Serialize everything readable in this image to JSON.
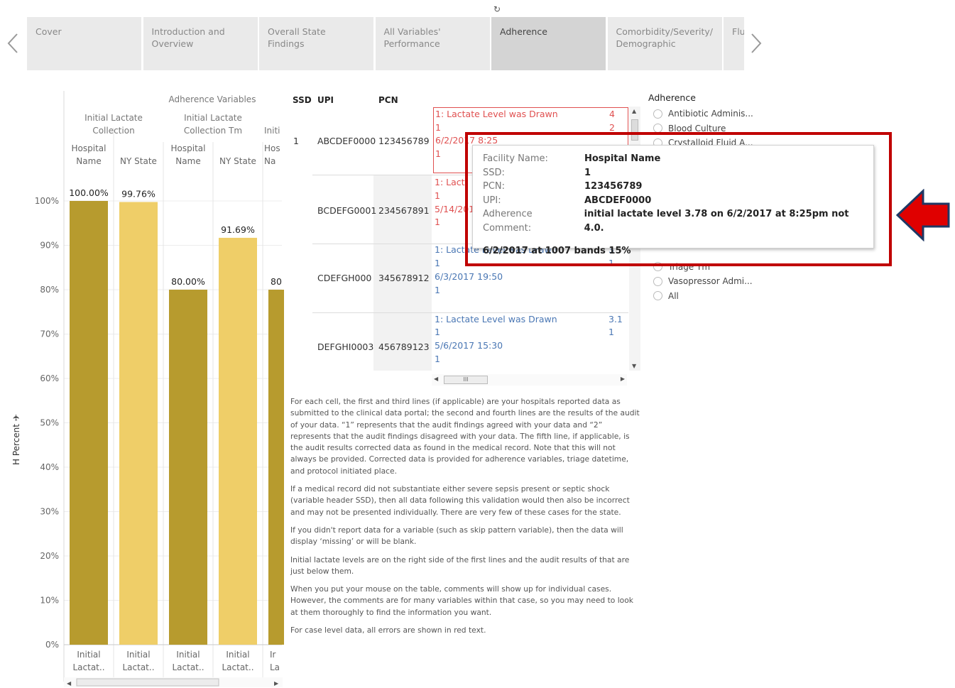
{
  "toolbar": {
    "reset_icon": "revert-icon",
    "reset_glyph": "↻"
  },
  "tabs": [
    {
      "label": "Cover"
    },
    {
      "label": "Introduction and Overview"
    },
    {
      "label": "Overall State Findings"
    },
    {
      "label": "All Variables' Performance"
    },
    {
      "label": "Adherence"
    },
    {
      "label": "Comorbidity/Severity/ Demographic"
    },
    {
      "label": "Flu"
    }
  ],
  "chart_data": {
    "type": "bar",
    "group_title": "Adherence Variables",
    "groups": [
      "Initial Lactate Collection",
      "Initial Lactate Collection Tm",
      "Initi"
    ],
    "subheaders": [
      "Hospital Name",
      "NY State",
      "Hospital Name",
      "NY State",
      "Hos Na"
    ],
    "categories": [
      "Initial Lactat..",
      "Initial Lactat..",
      "Initial Lactat..",
      "Initial Lactat..",
      "Ir La"
    ],
    "series": [
      {
        "values": [
          100.0,
          99.76,
          80.0,
          91.69,
          80.0
        ]
      }
    ],
    "data_labels": [
      "100.00%",
      "99.76%",
      "80.00%",
      "91.69%",
      "80"
    ],
    "ylabel": "H Percent",
    "yticks": [
      "0%",
      "10%",
      "20%",
      "30%",
      "40%",
      "50%",
      "60%",
      "70%",
      "80%",
      "90%",
      "100%"
    ],
    "ylim": [
      0,
      100
    ],
    "colors": {
      "hospital": "#b79b2e",
      "state": "#efce68"
    }
  },
  "table": {
    "headers": {
      "ssd": "SSD",
      "upi": "UPI",
      "pcn": "PCN"
    },
    "rows": [
      {
        "ssd": "1",
        "upi": "ABCDEF0000",
        "pcn": "123456789",
        "l1": "1: Lactate Level was Drawn",
        "l2": "1",
        "l3": "6/2/2017 8:25",
        "l4": "1",
        "v1": "4",
        "v2": "2",
        "error": true
      },
      {
        "ssd": "",
        "upi": "BCDEFG0001",
        "pcn": "234567891",
        "l1": "1: Lact",
        "l2": "1",
        "l3": "5/14/201",
        "l4": "1",
        "v1": "",
        "v2": "",
        "error": true
      },
      {
        "ssd": "",
        "upi": "CDEFGH000",
        "pcn": "345678912",
        "l1": "1: Lactate Level was Drawn",
        "l2": "1",
        "l3": "6/3/2017 19:50",
        "l4": "1",
        "v1": "3",
        "v2": "1",
        "error": false
      },
      {
        "ssd": "",
        "upi": "DEFGHI0003",
        "pcn": "456789123",
        "l1": "1: Lactate Level was Drawn",
        "l2": "1",
        "l3": "5/6/2017 15:30",
        "l4": "1",
        "v1": "3.1",
        "v2": "1",
        "error": false
      }
    ]
  },
  "notes": [
    "For each cell, the first and third lines (if applicable) are your hospitals reported data as submitted to the clinical data portal; the second and fourth lines are the results of the audit of your data. “1” represents that the audit findings agreed with your data and “2” represents that the audit findings disagreed with your data. The fifth line, if applicable, is the audit results corrected data as found in the medical record.  Note that this will not always be provided.  Corrected data is provided for adherence variables, triage datetime, and protocol initiated place.",
    "If a medical record did not substantiate either severe sepsis present or septic shock (variable header SSD), then all data following this validation would then also be incorrect and may not be presented individually.  There are very few of these cases for the state.",
    "If you didn't report data for a variable (such as skip pattern variable), then the data will display ‘missing’ or will be blank.",
    "Initial lactate levels are on the right side of the first lines and the audit results of that are just below them.",
    "When you put your mouse on the table, comments will show up for individual cases. However, the comments are for many variables within that case, so you may need to look at them thoroughly to find the information you want.",
    "For case level data, all errors are shown in red text."
  ],
  "filter": {
    "title": "Adherence",
    "top_items": [
      "Antibiotic Adminis...",
      "Blood Culture",
      "Crystalloid Fluid A..."
    ],
    "bottom_items": [
      "Triage Tm",
      "Vasopressor Admi...",
      "All"
    ]
  },
  "tooltip": {
    "facility_label": "Facility Name:",
    "facility_value": "Hospital Name",
    "ssd_label": "SSD:",
    "ssd_value": "1",
    "pcn_label": "PCN:",
    "pcn_value": "123456789",
    "upi_label": "UPI:",
    "upi_value": "ABCDEF0000",
    "comment_label": "Adherence Comment:",
    "comment_value": "initial lactate level 3.78 on 6/2/2017 at 8:25pm not 4.0.",
    "extra": "6/2/2017 at 1007 bands 15%"
  },
  "annotation": {
    "box_color": "#c00000",
    "arrow_color": "#e00000",
    "arrow_outline": "#1f3864"
  }
}
